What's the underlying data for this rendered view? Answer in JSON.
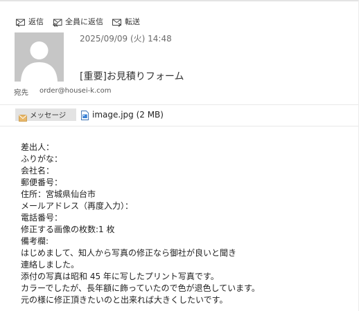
{
  "toolbar": {
    "reply": "返信",
    "reply_all": "全員に返信",
    "forward": "転送"
  },
  "header": {
    "datetime": "2025/09/09 (火) 14:48",
    "subject": "[重要]お見積りフォーム",
    "to_label": "宛先",
    "to_value": "order@housei-k.com"
  },
  "tabs": {
    "message": "メッセージ",
    "attachment": "image.jpg (2 MB)"
  },
  "body": {
    "lines": [
      "差出人：",
      "ふりがな：",
      "会社名：",
      "郵便番号：",
      "住所：宮城県仙台市",
      "メールアドレス（再度入力）：",
      "電話番号：",
      "修正する画像の枚数:1 枚",
      "備考欄:",
      "はじめまして、知人から写真の修正なら御社が良いと聞き",
      "連絡しました。",
      "添付の写真は昭和 45 年に写したプリント写真です。",
      "カラーでしたが、長年額に飾っていたので色が退色しています。",
      "元の様に修正頂きたいのと出来れば大きくしたいです。"
    ]
  },
  "colors": {
    "avatar_bg": "#c6c6c6",
    "tab_bg": "#e3e3e3",
    "envelope": "#e8b768",
    "icon": "#444444"
  }
}
